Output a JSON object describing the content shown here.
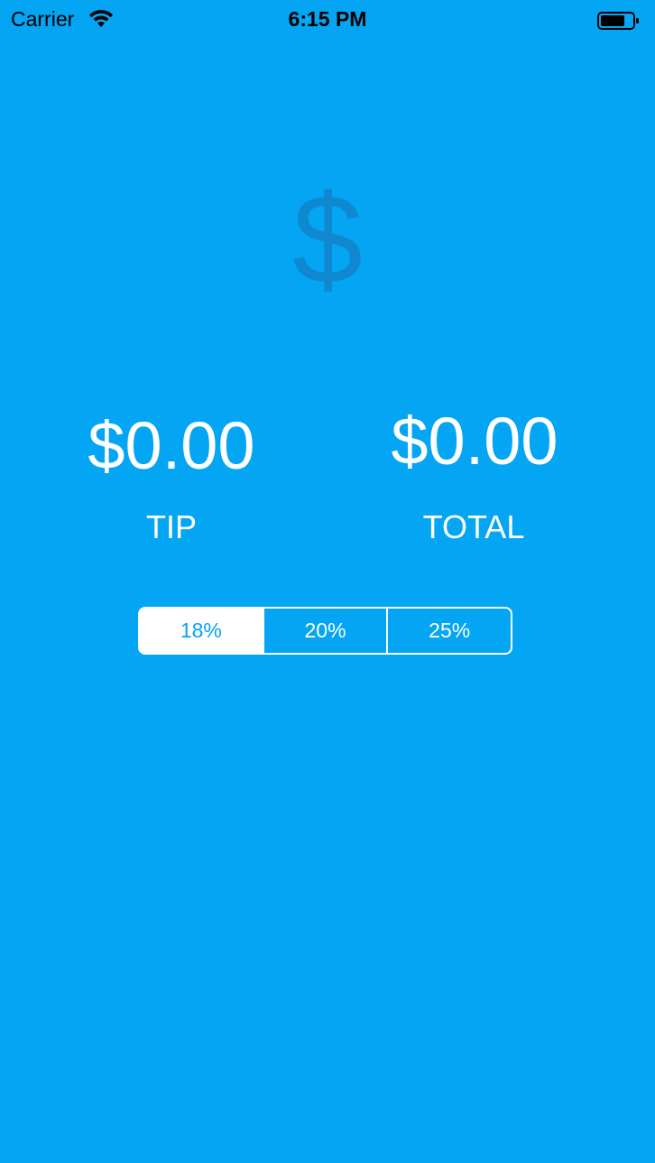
{
  "status_bar": {
    "carrier": "Carrier",
    "time": "6:15 PM",
    "wifi_icon": "wifi-icon",
    "battery_icon": "battery-icon"
  },
  "colors": {
    "background": "#04a5f3",
    "dollar_icon": "#1283c9",
    "text": "#ffffff"
  },
  "header": {
    "icon_glyph": "$",
    "icon_name": "dollar-sign-icon"
  },
  "results": {
    "tip_amount": "$0.00",
    "tip_label": "TIP",
    "total_amount": "$0.00",
    "total_label": "TOTAL"
  },
  "tip_selector": {
    "options": [
      "18%",
      "20%",
      "25%"
    ],
    "selected": "18%"
  }
}
